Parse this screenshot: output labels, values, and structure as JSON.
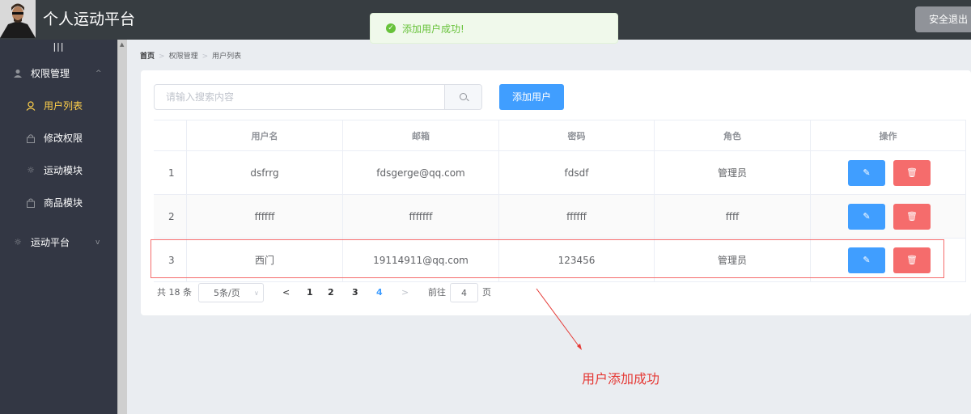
{
  "header": {
    "title": "个人运动平台",
    "logout_label": "安全退出",
    "avatar_alt": "avatar"
  },
  "toast": {
    "message": "添加用户成功!",
    "type": "success",
    "icon": "check-circle-icon"
  },
  "sidebar": {
    "collapse_label": "|||",
    "items": [
      {
        "label": "权限管理",
        "icon": "user-icon",
        "type": "submenu",
        "expanded": true
      },
      {
        "label": "用户列表",
        "icon": "user-outline-icon",
        "type": "item",
        "active": true
      },
      {
        "label": "修改权限",
        "icon": "lock-icon",
        "type": "item"
      },
      {
        "label": "运动模块",
        "icon": "sun-icon",
        "type": "item"
      },
      {
        "label": "商品模块",
        "icon": "goods-icon",
        "type": "item"
      },
      {
        "label": "运动平台",
        "icon": "sun-icon",
        "type": "submenu",
        "expanded": false
      }
    ]
  },
  "breadcrumb": [
    "首页",
    "权限管理",
    "用户列表"
  ],
  "search": {
    "placeholder": "请输入搜索内容",
    "value": ""
  },
  "add_user_label": "添加用户",
  "table": {
    "columns": [
      "",
      "用户名",
      "邮箱",
      "密码",
      "角色",
      "操作"
    ],
    "rows": [
      {
        "index": "1",
        "username": "dsfrrg",
        "email": "fdsgerge@qq.com",
        "password": "fdsdf",
        "role": "管理员"
      },
      {
        "index": "2",
        "username": "ffffff",
        "email": "fffffff",
        "password": "ffffff",
        "role": "ffff"
      },
      {
        "index": "3",
        "username": "西门",
        "email": "19114911@qq.com",
        "password": "123456",
        "role": "管理员"
      }
    ],
    "highlighted_row": 3
  },
  "pagination": {
    "total_label": "共 18 条",
    "page_size_label": "5条/页",
    "pages": [
      "1",
      "2",
      "3",
      "4"
    ],
    "current_page": "4",
    "goto_label": "前往",
    "goto_value": "4",
    "page_suffix": "页"
  },
  "annotation": {
    "text": "用户添加成功",
    "color": "#e53935"
  },
  "colors": {
    "primary": "#409eff",
    "danger": "#f56c6c",
    "success": "#67c23a",
    "menu_active": "#ffd04b",
    "sidebar_bg": "#333744",
    "header_bg": "#373d41"
  }
}
